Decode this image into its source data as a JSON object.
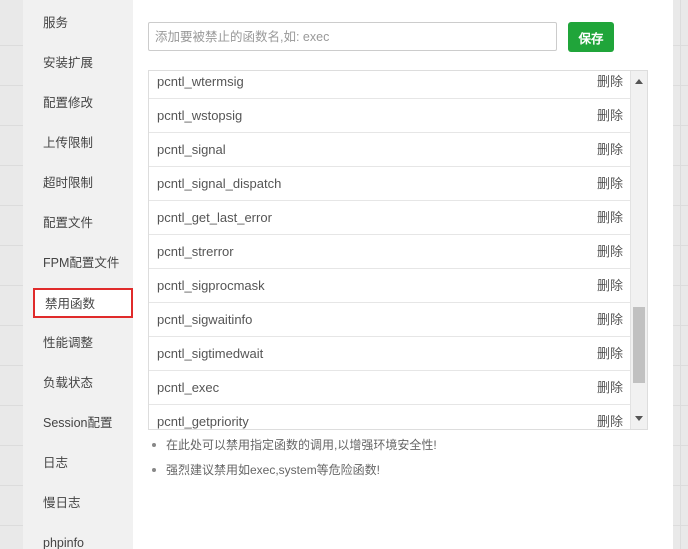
{
  "sidebar": {
    "items": [
      {
        "label": "服务"
      },
      {
        "label": "安装扩展"
      },
      {
        "label": "配置修改"
      },
      {
        "label": "上传限制"
      },
      {
        "label": "超时限制"
      },
      {
        "label": "配置文件"
      },
      {
        "label": "FPM配置文件"
      },
      {
        "label": "禁用函数"
      },
      {
        "label": "性能调整"
      },
      {
        "label": "负载状态"
      },
      {
        "label": "Session配置"
      },
      {
        "label": "日志"
      },
      {
        "label": "慢日志"
      },
      {
        "label": "phpinfo"
      }
    ],
    "active_index": 7
  },
  "form": {
    "placeholder": "添加要被禁止的函数名,如: exec",
    "value": "",
    "save_label": "保存"
  },
  "functions": {
    "delete_label": "删除",
    "rows": [
      "pcntl_wtermsig",
      "pcntl_wstopsig",
      "pcntl_signal",
      "pcntl_signal_dispatch",
      "pcntl_get_last_error",
      "pcntl_strerror",
      "pcntl_sigprocmask",
      "pcntl_sigwaitinfo",
      "pcntl_sigtimedwait",
      "pcntl_exec",
      "pcntl_getpriority"
    ]
  },
  "tips": [
    "在此处可以禁用指定函数的调用,以增强环境安全性!",
    "强烈建议禁用如exec,system等危险函数!"
  ]
}
